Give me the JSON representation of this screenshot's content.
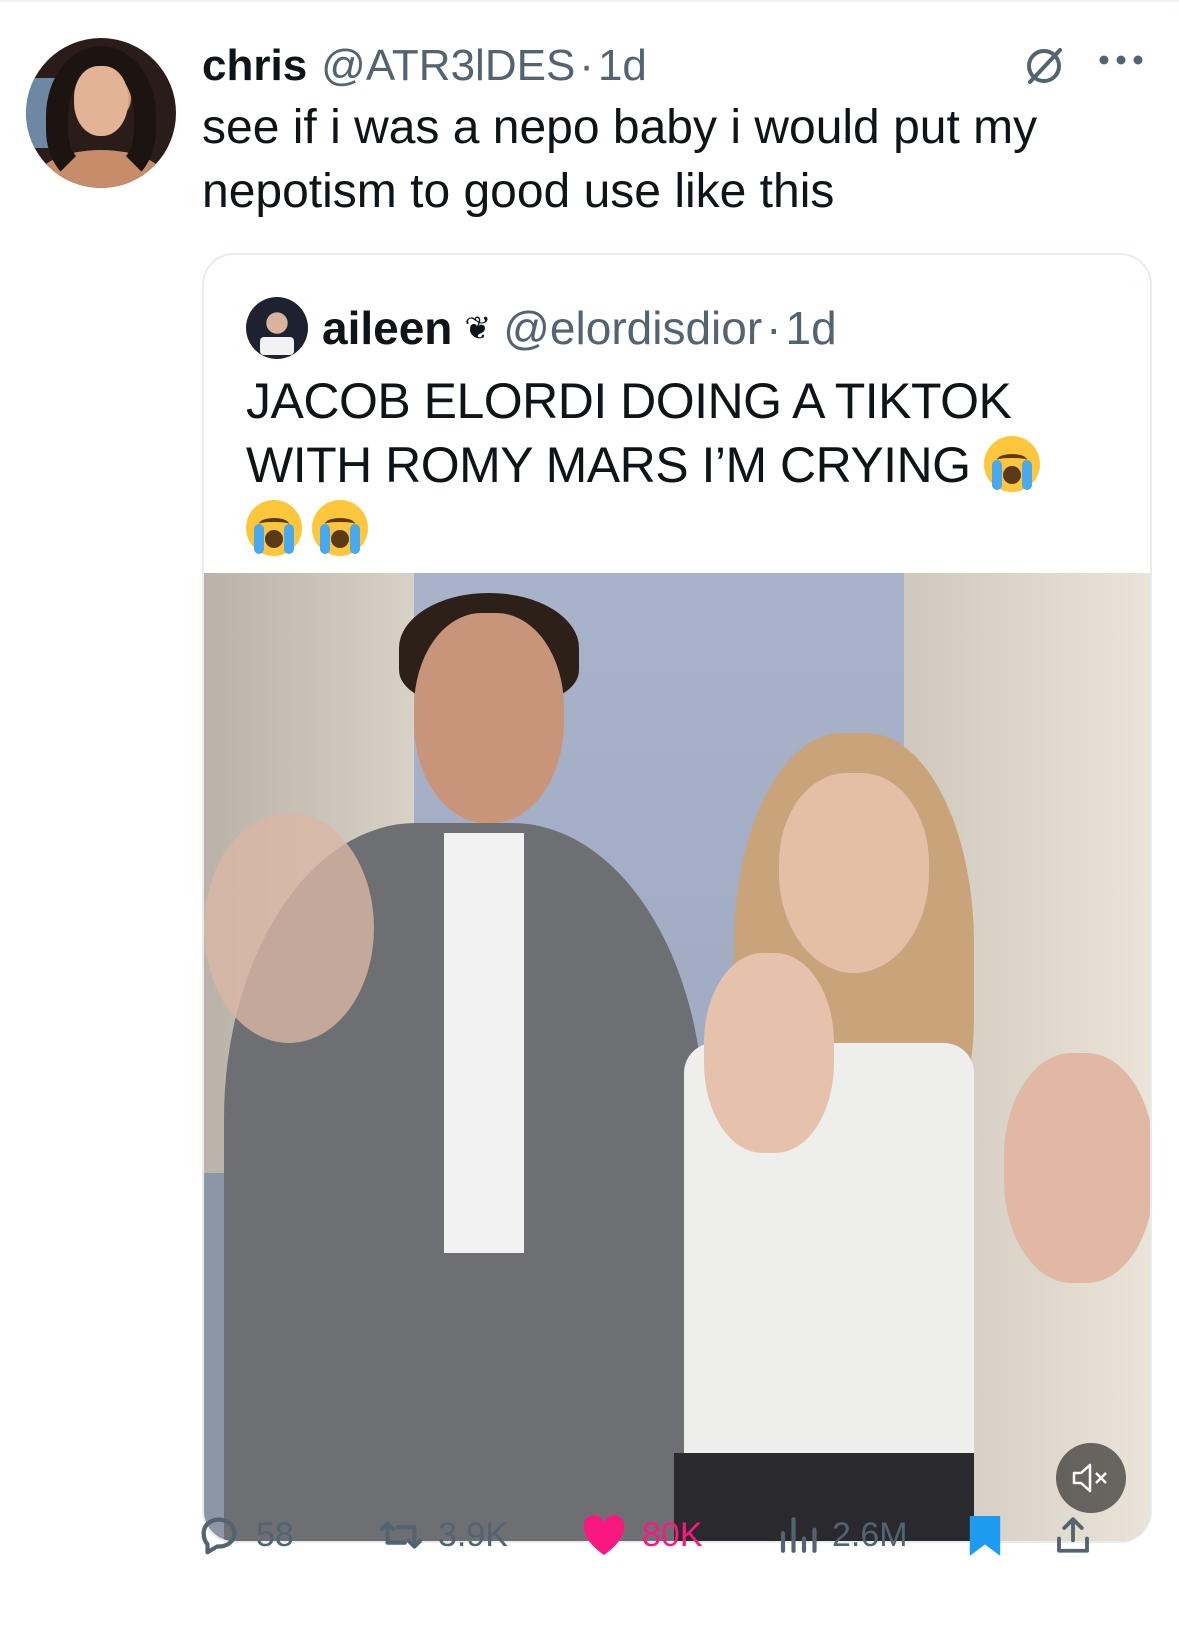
{
  "tweet": {
    "author_name": "chris",
    "author_handle": "@ATR3lDES",
    "separator": "·",
    "time": "1d",
    "text": "see if i was a nepo baby i would put my nepotism to good use like this"
  },
  "quoted": {
    "author_name": "aileen",
    "author_badge": "❦",
    "author_handle": "@elordisdior",
    "separator": "·",
    "time": "1d",
    "text": "JACOB ELORDI DOING A TIKTOK WITH ROMY MARS I’M CRYING",
    "emoji": [
      "loudly-crying-face",
      "loudly-crying-face",
      "loudly-crying-face"
    ]
  },
  "actions": {
    "replies": "58",
    "reposts": "3.9K",
    "likes": "80K",
    "views": "2.6M"
  },
  "colors": {
    "text": "#0f1419",
    "secondary": "#536471",
    "like": "#f91880",
    "bookmark": "#1d9bf0",
    "border": "#e6ecf0"
  },
  "icons": [
    "grok-icon",
    "more-icon",
    "mute-icon",
    "reply-icon",
    "repost-icon",
    "heart-icon",
    "views-icon",
    "bookmark-icon",
    "share-icon"
  ]
}
